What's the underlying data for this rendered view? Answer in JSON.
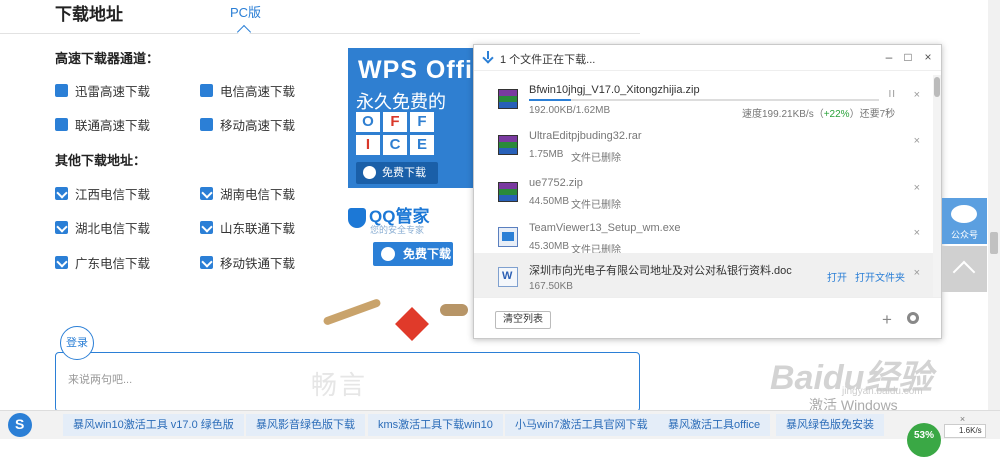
{
  "header": {
    "title": "下载地址",
    "pc_tab": "PC版"
  },
  "fast_section": {
    "title": "高速下载器通道：",
    "items": [
      "迅雷高速下载",
      "电信高速下载",
      "联通高速下载",
      "移动高速下载"
    ]
  },
  "other_section": {
    "title": "其他下载地址：",
    "items": [
      "江西电信下载",
      "湖南电信下载",
      "湖北电信下载",
      "山东联通下载",
      "广东电信下载",
      "移动铁通下载"
    ]
  },
  "wps_ad": {
    "logo": "WPS Offi",
    "slogan": "永久免费的",
    "letters": [
      "O",
      "F",
      "F",
      "I",
      "C",
      "E"
    ],
    "button": "免费下载"
  },
  "qq_ad": {
    "logo": "QQ管家",
    "sub": "您的安全专家",
    "button": "免费下载"
  },
  "comment": {
    "login": "登录",
    "placeholder": "来说两句吧...",
    "brand": "畅言"
  },
  "download_manager": {
    "title": "1 个文件正在下载...",
    "files": [
      {
        "name": "Bfwin10jhgj_V17.0_Xitongzhijia.zip",
        "progress_text": "192.00KB/1.62MB",
        "speed_prefix": "速度199.21KB/s（",
        "speed_pct": "+22%",
        "speed_suffix": "）还要7秒",
        "progress": 0.12,
        "pause": "II",
        "close": "×"
      },
      {
        "name": "UltraEditpjbuding32.rar",
        "size": "1.75MB",
        "status": "文件已删除",
        "close": "×"
      },
      {
        "name": "ue7752.zip",
        "size": "44.50MB",
        "status": "文件已删除",
        "close": "×"
      },
      {
        "name": "TeamViewer13_Setup_wm.exe",
        "size": "45.30MB",
        "status": "文件已删除",
        "close": "×"
      },
      {
        "name": "深圳市向光电子有限公司地址及对公对私银行资料.doc",
        "size": "167.50KB",
        "open": "打开",
        "open_folder": "打开文件夹",
        "close": "×"
      }
    ],
    "clear_button": "清空列表",
    "add": "+",
    "window_controls": {
      "min": "–",
      "max": "□",
      "close": "×"
    }
  },
  "float": {
    "wechat_label": "公众号"
  },
  "watermark": {
    "baidu": "Baidu经验",
    "baidu_sub": "jingyan.baidu.com",
    "activate": "激活 Windows"
  },
  "bottom_tags": [
    "暴风win10激活工具 v17.0 绿色版",
    "暴风影音绿色版下载",
    "kms激活工具下载win10",
    "小马win7激活工具官网下载",
    "暴风激活工具office",
    "暴风绿色版免安装"
  ],
  "tray": {
    "battery": "53%",
    "net_speed": "1.6K/s",
    "close": "×"
  },
  "colors": {
    "accent": "#2b7fd6",
    "progress": "#2b7fd6",
    "positive": "#2aa33a"
  }
}
